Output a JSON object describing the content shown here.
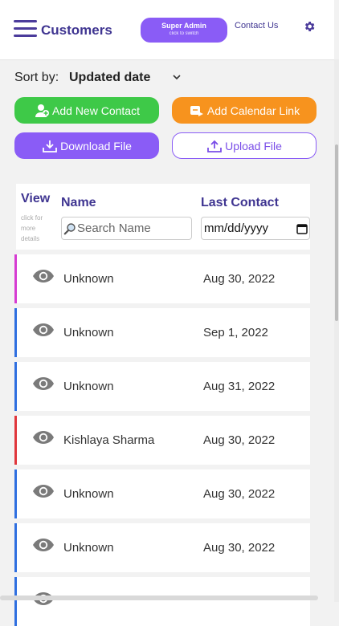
{
  "header": {
    "brand": "Customers",
    "role": "Super Admin",
    "role_hint": "click to switch",
    "contact": "Contact Us"
  },
  "sort": {
    "label": "Sort by:",
    "value": "Updated date"
  },
  "actions": {
    "add_contact": "Add New Contact",
    "calendar_link": "Add Calendar Link",
    "download": "Download File",
    "upload": "Upload File"
  },
  "table": {
    "col_view": "View",
    "view_note": "click for more details",
    "col_name": "Name",
    "col_last": "Last Contact",
    "search_placeholder": "Search Name",
    "date_placeholder": "mm/dd/yyyy",
    "rows": [
      {
        "name": "Unknown",
        "date": "Aug 30, 2022",
        "accent": "#d63bd2"
      },
      {
        "name": "Unknown",
        "date": "Sep 1, 2022",
        "accent": "#2f6fe0"
      },
      {
        "name": "Unknown",
        "date": "Aug 31, 2022",
        "accent": "#2f6fe0"
      },
      {
        "name": "Kishlaya Sharma",
        "date": "Aug 30, 2022",
        "accent": "#e0363c"
      },
      {
        "name": "Unknown",
        "date": "Aug 30, 2022",
        "accent": "#2f6fe0"
      },
      {
        "name": "Unknown",
        "date": "Aug 30, 2022",
        "accent": "#2f6fe0"
      },
      {
        "name": "",
        "date": "",
        "accent": "#2f6fe0"
      }
    ]
  },
  "colors": {
    "brand": "#3f3591",
    "green": "#3ec948",
    "orange": "#f7931e",
    "purple": "#8a5cf6"
  }
}
